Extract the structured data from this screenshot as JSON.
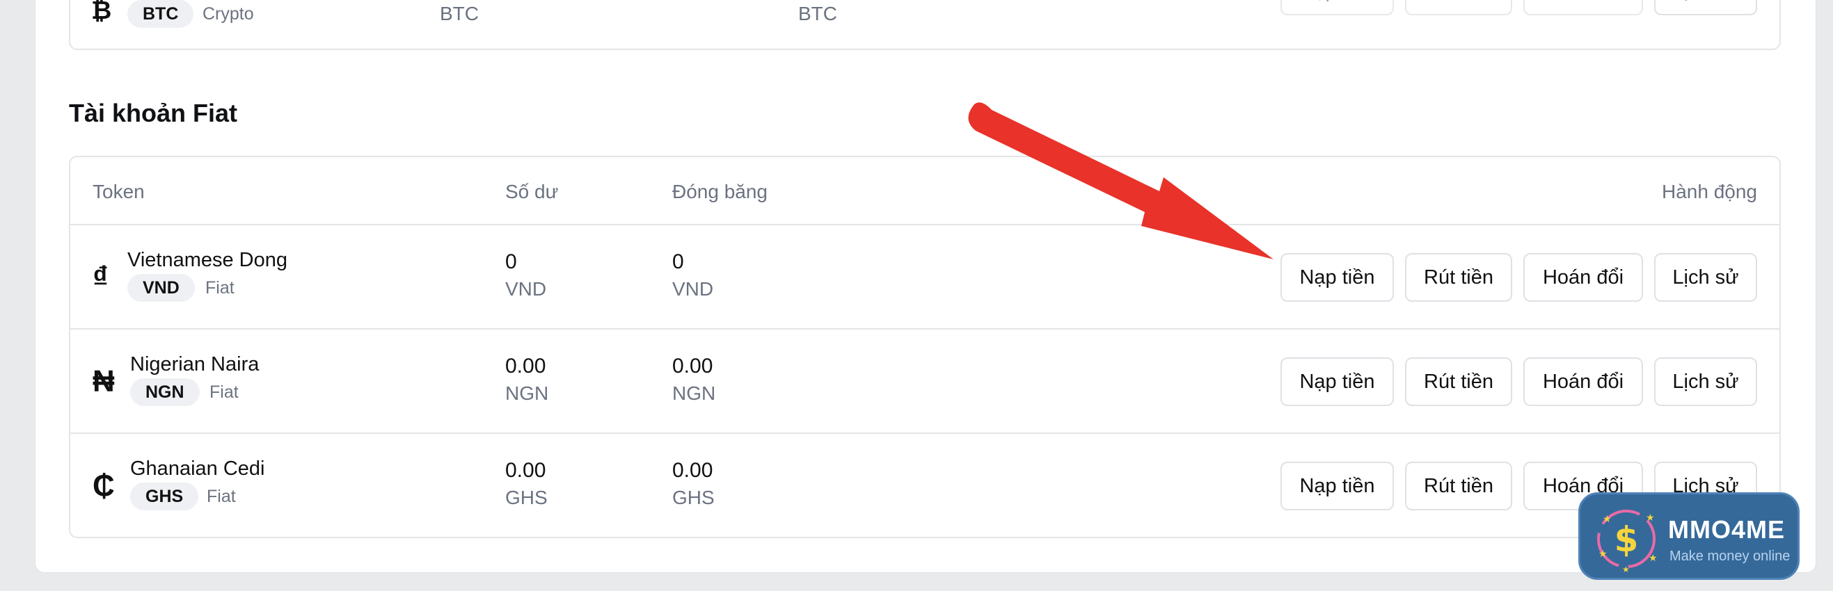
{
  "crypto_partial_row": {
    "symbol": "₿",
    "code": "BTC",
    "kind": "Crypto",
    "balance_unit": "BTC",
    "frozen_unit": "BTC",
    "actions": [
      "Nạp tiền",
      "Rút tiền",
      "Hoán đổi",
      "Lịch sử"
    ]
  },
  "fiat_section": {
    "title": "Tài khoản Fiat",
    "headers": {
      "token": "Token",
      "balance": "Số dư",
      "frozen": "Đóng băng",
      "actions": "Hành động"
    },
    "rows": [
      {
        "symbol": "₫",
        "name": "Vietnamese Dong",
        "code": "VND",
        "kind": "Fiat",
        "balance": "0",
        "balance_unit": "VND",
        "frozen": "0",
        "frozen_unit": "VND"
      },
      {
        "symbol": "₦",
        "name": "Nigerian Naira",
        "code": "NGN",
        "kind": "Fiat",
        "balance": "0.00",
        "balance_unit": "NGN",
        "frozen": "0.00",
        "frozen_unit": "NGN"
      },
      {
        "symbol": "₵",
        "name": "Ghanaian Cedi",
        "code": "GHS",
        "kind": "Fiat",
        "balance": "0.00",
        "balance_unit": "GHS",
        "frozen": "0.00",
        "frozen_unit": "GHS"
      }
    ],
    "actions": {
      "deposit": "Nạp tiền",
      "withdraw": "Rút tiền",
      "swap": "Hoán đổi",
      "history": "Lịch sử"
    }
  },
  "annotation": {
    "arrow_color": "#e8322a",
    "arrow_target": "deposit-button"
  },
  "watermark": {
    "logo_icon": "dollar-cycle-logo",
    "title": "MMO4ME",
    "subtitle": "Make money online",
    "bg_color": "#35699a"
  }
}
